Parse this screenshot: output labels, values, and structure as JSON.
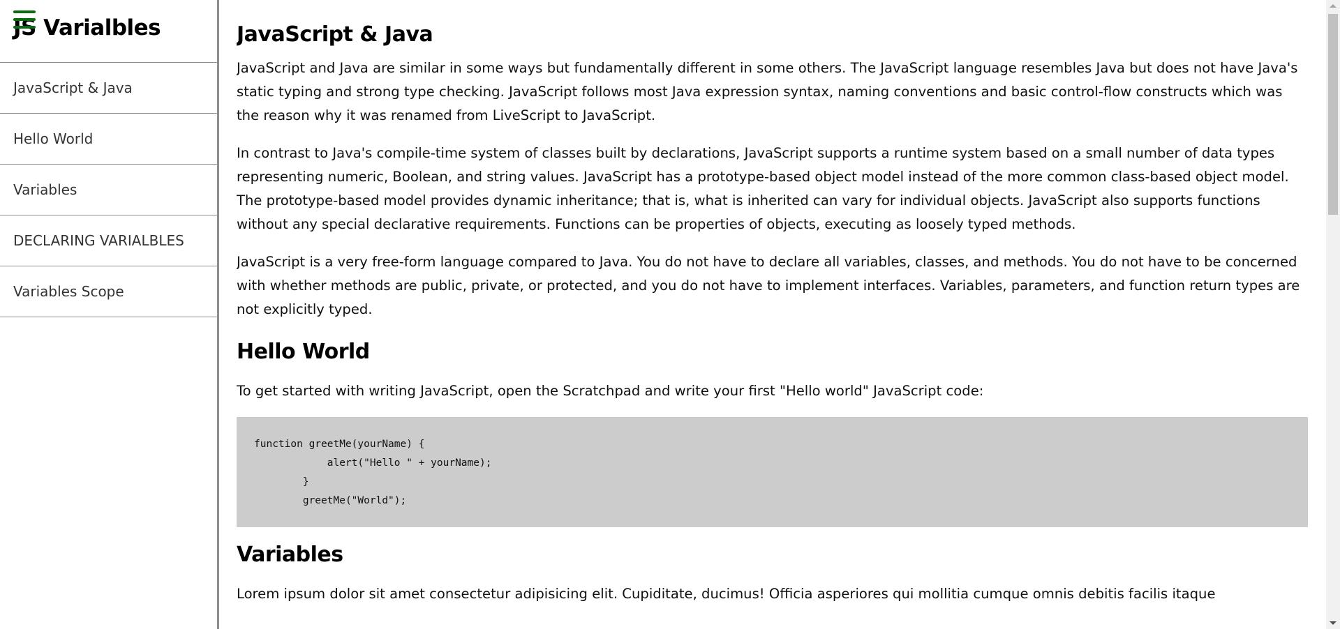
{
  "sidebar": {
    "title": "JS Varialbles",
    "items": [
      {
        "label": "JavaScript & Java"
      },
      {
        "label": "Hello World"
      },
      {
        "label": "Variables"
      },
      {
        "label": "DECLARING VARIALBLES"
      },
      {
        "label": "Variables Scope"
      }
    ]
  },
  "main": {
    "sections": [
      {
        "heading": "JavaScript & Java",
        "paragraphs": [
          "JavaScript and Java are similar in some ways but fundamentally different in some others. The JavaScript language resembles Java but does not have Java's static typing and strong type checking. JavaScript follows most Java expression syntax, naming conventions and basic control-flow constructs which was the reason why it was renamed from LiveScript to JavaScript.",
          "In contrast to Java's compile-time system of classes built by declarations, JavaScript supports a runtime system based on a small number of data types representing numeric, Boolean, and string values. JavaScript has a prototype-based object model instead of the more common class-based object model. The prototype-based model provides dynamic inheritance; that is, what is inherited can vary for individual objects. JavaScript also supports functions without any special declarative requirements. Functions can be properties of objects, executing as loosely typed methods.",
          "JavaScript is a very free-form language compared to Java. You do not have to declare all variables, classes, and methods. You do not have to be concerned with whether methods are public, private, or protected, and you do not have to implement interfaces. Variables, parameters, and function return types are not explicitly typed."
        ]
      },
      {
        "heading": "Hello World",
        "paragraphs": [
          "To get started with writing JavaScript, open the Scratchpad and write your first \"Hello world\" JavaScript code:"
        ],
        "code": "function greetMe(yourName) {\n            alert(\"Hello \" + yourName);\n        }\n        greetMe(\"World\");"
      },
      {
        "heading": "Variables",
        "paragraphs": [
          "Lorem ipsum dolor sit amet consectetur adipisicing elit. Cupiditate, ducimus! Officia asperiores qui mollitia cumque omnis debitis facilis itaque"
        ]
      }
    ]
  },
  "colors": {
    "hamburger": "#0b6b11",
    "code_bg": "#cccccc",
    "border": "#8c8c8c"
  },
  "icons": {
    "menu": "hamburger-menu-icon"
  }
}
